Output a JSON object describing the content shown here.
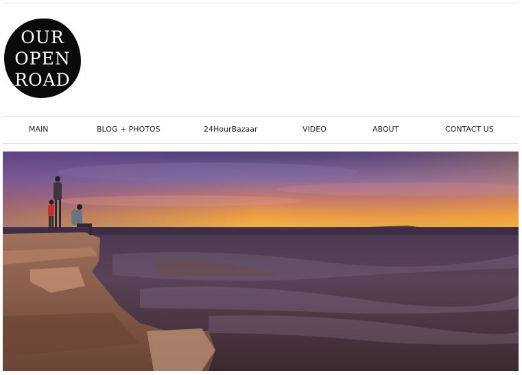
{
  "logo": {
    "line1": "OUR",
    "line2": "OPEN",
    "line3": "ROAD"
  },
  "nav": {
    "items": [
      {
        "label": "MAIN"
      },
      {
        "label": "BLOG + PHOTOS"
      },
      {
        "label": "24HourBazaar"
      },
      {
        "label": "VIDEO"
      },
      {
        "label": "ABOUT"
      },
      {
        "label": "CONTACT US"
      }
    ]
  },
  "colors": {
    "logo_background": "#0a0a0a",
    "nav_text": "#222222",
    "divider": "#dcdcdc",
    "sky_top": "#5a4a8a",
    "sky_horizon": "#f2a23a",
    "ground": "#3a2a3a"
  }
}
